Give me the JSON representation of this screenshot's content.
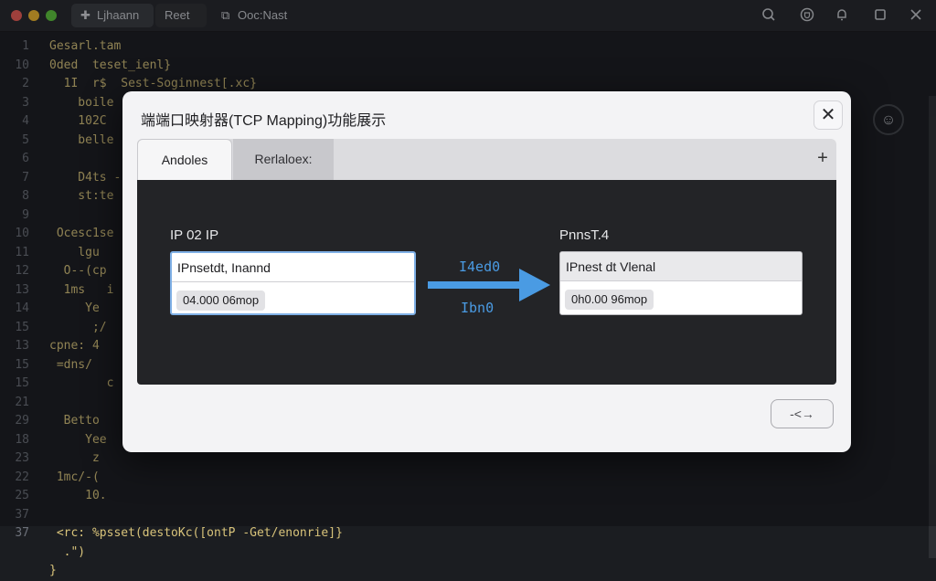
{
  "window": {
    "tabs": [
      {
        "icon": "plus-icon",
        "label": "Ljhaann"
      },
      {
        "label": "Reet"
      },
      {
        "icon": "file-tab-icon",
        "label": "Ooc:Nast"
      }
    ],
    "toolbar_icons": [
      "search-icon",
      "shield-icon",
      "bell-icon",
      "maximize-icon",
      "close-icon"
    ]
  },
  "editor": {
    "line_numbers": [
      "1",
      "10",
      "2",
      "3",
      "4",
      "5",
      "6",
      "7",
      "8",
      "9",
      "10",
      "11",
      "12",
      "13",
      "14",
      "15",
      "13",
      "15",
      "15",
      "21",
      "29",
      "18",
      "23",
      "22",
      "25",
      "37",
      "37"
    ],
    "lines": [
      "Gesarl.tam",
      "0ded  teset_ienl}",
      "  1I  r$  Sest-Soginnest[.xc}",
      "    boile",
      "    102C",
      "    belle",
      "",
      "    D4ts -",
      "    st:te",
      "",
      " Ocesc1se",
      "    lgu",
      "  O--(cp",
      "  1ms   i",
      "     Ye",
      "      ;/",
      "cpne: 4",
      " =dns/",
      "        c",
      "",
      "  Betto",
      "     Yee",
      "      z",
      " 1mc/-(",
      "     10.",
      "",
      " <rc: %psset(destoKc([ontP -Get/enonrie]}",
      "  .\")",
      "}"
    ]
  },
  "dialog": {
    "title": "端端口映射器(TCP Mapping)功能展示",
    "close_label": "✕",
    "tabs": [
      {
        "label": "Andoles",
        "active": true
      },
      {
        "label": "Rerlaloex:",
        "active": false
      }
    ],
    "add_tab_label": "+",
    "source": {
      "label": "IP 02 IP",
      "input_value": "IPnsetdt, Inannd",
      "chip": "04.000 06mop"
    },
    "arrow": {
      "top_label": "I4ed0",
      "bottom_label": "Ibn0"
    },
    "target": {
      "label": "PnnsT.4",
      "input_value": "IPnest dt Vlenal",
      "chip": "0h0.00 96mop"
    },
    "action_button": "-<→"
  },
  "colors": {
    "accent": "#4a9be3",
    "code_text": "#d8c37a",
    "panel": "#232427"
  }
}
